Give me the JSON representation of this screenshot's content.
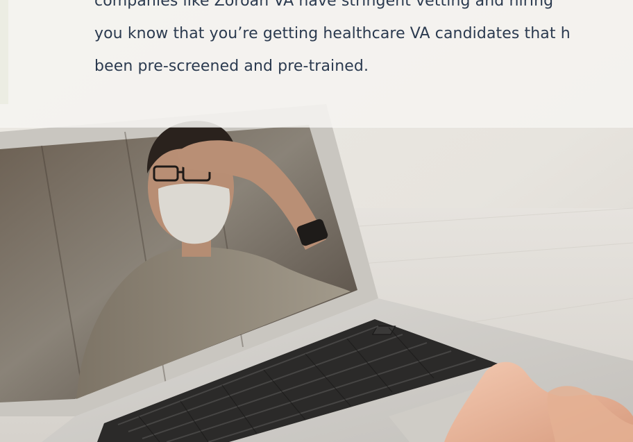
{
  "article": {
    "lines": [
      "companies like Zoroan VA have stringent vetting and hiring",
      "you know that you’re getting healthcare VA candidates that h",
      "been pre-screened and pre-trained."
    ]
  },
  "photo": {
    "subject": "video-call-on-laptop"
  },
  "colors": {
    "text": "#2b3a4f",
    "panel": "#f5f4f0"
  }
}
